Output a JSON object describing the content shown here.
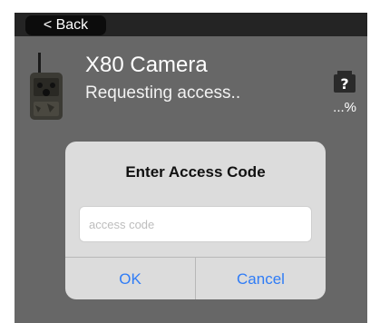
{
  "nav": {
    "back_label": "< Back"
  },
  "device": {
    "name": "X80 Camera",
    "status": "Requesting access..",
    "progress_text": "...%",
    "status_icon": "unknown-card-icon",
    "thumbnail_icon": "trail-camera-icon"
  },
  "dialog": {
    "title": "Enter Access Code",
    "input": {
      "placeholder": "access code",
      "value": ""
    },
    "ok_label": "OK",
    "cancel_label": "Cancel"
  },
  "colors": {
    "background": "#676767",
    "topbar": "#242424",
    "dialog": "#dcdcdc",
    "accent": "#2f7cf6"
  }
}
